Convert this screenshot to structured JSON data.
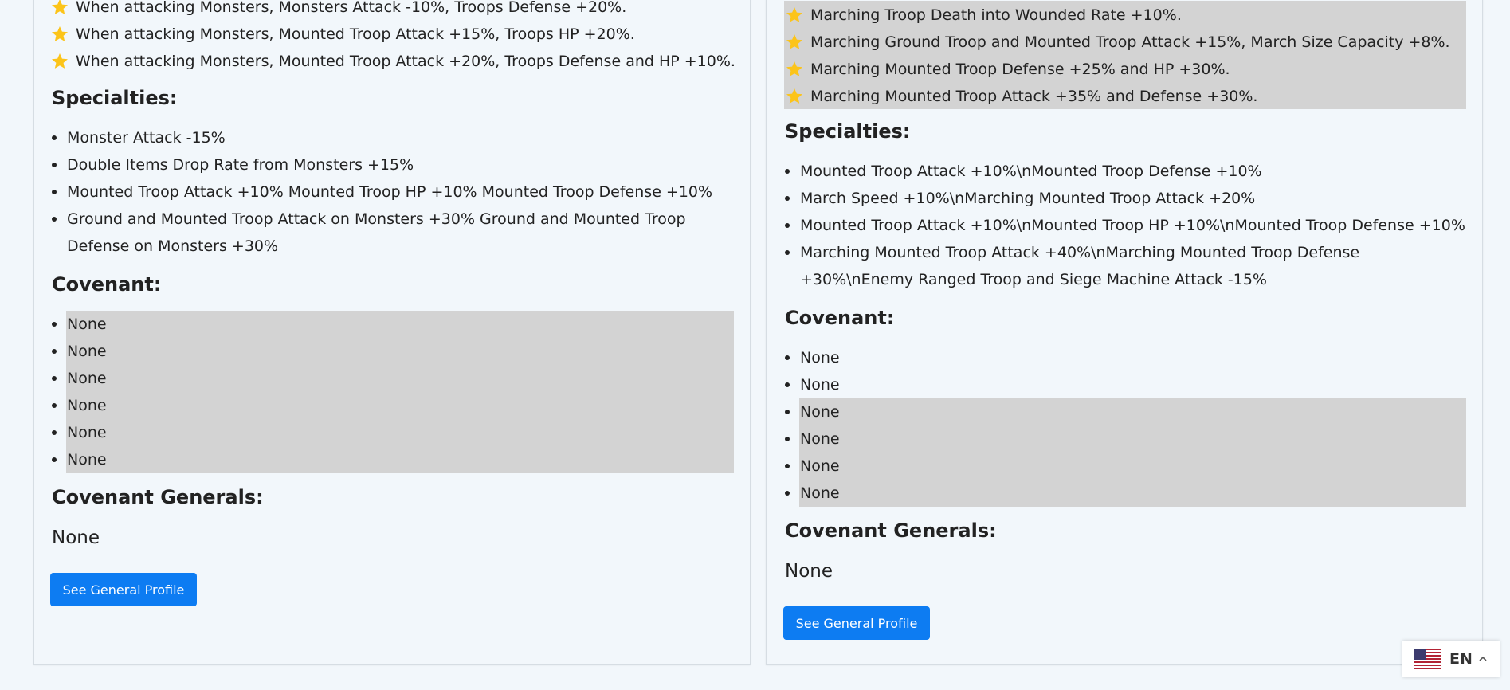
{
  "left": {
    "stars": [
      "When attacking Monsters, Monsters Attack -10%, Troops Defense +20%.",
      "When attacking Monsters, Mounted Troop Attack +15%, Troops HP +20%.",
      "When attacking Monsters, Mounted Troop Attack +20%, Troops Defense and HP +10%."
    ],
    "specialties_heading": "Specialties:",
    "specialties": [
      "Monster Attack -15%",
      "Double Items Drop Rate from Monsters +15%",
      "Mounted Troop Attack +10% Mounted Troop HP +10% Mounted Troop Defense +10%",
      "Ground and Mounted Troop Attack on Monsters +30% Ground and Mounted Troop Defense on Monsters +30%"
    ],
    "covenant_heading": "Covenant:",
    "covenant": [
      "None",
      "None",
      "None",
      "None",
      "None",
      "None"
    ],
    "covenant_generals_heading": "Covenant Generals:",
    "covenant_generals_value": "None",
    "profile_button": "See General Profile"
  },
  "right": {
    "stars": [
      "Marching Troop Death into Wounded Rate +10%.",
      "Marching Ground Troop and Mounted Troop Attack +15%, March Size Capacity +8%.",
      "Marching Mounted Troop Defense +25% and HP +30%.",
      "Marching Mounted Troop Attack +35% and Defense +30%."
    ],
    "specialties_heading": "Specialties:",
    "specialties": [
      "Mounted Troop Attack +10%\\nMounted Troop Defense +10%",
      "March Speed +10%\\nMarching Mounted Troop Attack +20%",
      "Mounted Troop Attack +10%\\nMounted Troop HP +10%\\nMounted Troop Defense +10%",
      "Marching Mounted Troop Attack +40%\\nMarching Mounted Troop Defense +30%\\nEnemy Ranged Troop and Siege Machine Attack -15%"
    ],
    "covenant_heading": "Covenant:",
    "covenant": [
      "None",
      "None",
      "None",
      "None",
      "None",
      "None"
    ],
    "covenant_generals_heading": "Covenant Generals:",
    "covenant_generals_value": "None",
    "profile_button": "See General Profile"
  },
  "language": {
    "code": "EN",
    "flag_icon": "us-flag-icon"
  },
  "colors": {
    "button": "#0d7cf2",
    "highlight": "#d3d3d3",
    "star": "#fcc419",
    "background": "#f2f7fb"
  }
}
